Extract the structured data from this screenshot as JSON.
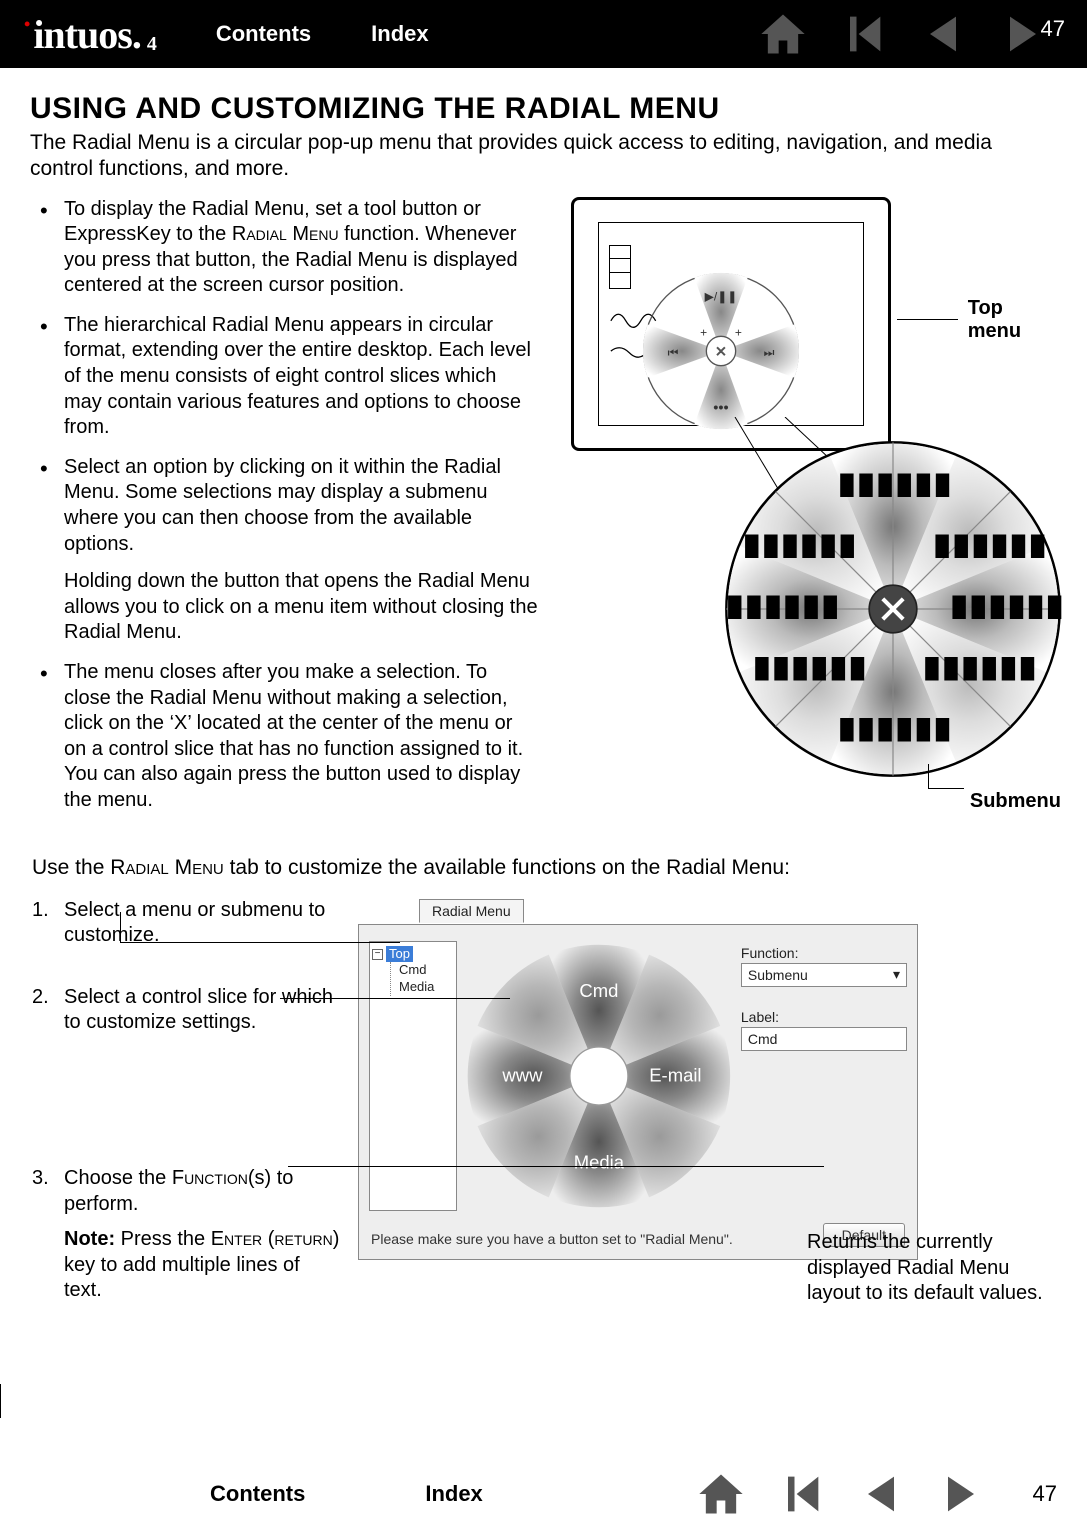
{
  "header": {
    "brand_main": "intuos",
    "brand_sub": "4",
    "contents": "Contents",
    "index": "Index",
    "page": "47"
  },
  "title": "USING AND CUSTOMIZING THE RADIAL MENU",
  "intro": "The Radial Menu is a circular pop-up menu that provides quick access to editing, navigation, and media control functions, and more.",
  "smallcaps": {
    "radial_menu": "Radial Menu",
    "function": "Function",
    "enter": "Enter",
    "return": "return"
  },
  "bullets": {
    "b1a": "To display the Radial Menu, set a tool button or ExpressKey to the ",
    "b1b": " function. Whenever you press that button, the Radial Menu is displayed centered at the screen cursor position.",
    "b2": "The hierarchical Radial Menu appears in circular format, extending over the entire desktop.  Each level of the menu consists of eight control slices which may contain various features and options to choose from.",
    "b3a": "Select an option by clicking on it within the Radial Menu.  Some selections may display a submenu where you can then choose from the available options.",
    "b3b": "Holding down the button that opens the Radial Menu allows you to click on a menu item without closing the Radial Menu.",
    "b4": "The menu closes after you make a selection.  To close the Radial Menu without making a selection, click on the ‘X’ located at the center of the menu or on a control slice that has no function assigned to it.  You can also again press the button used to display the menu."
  },
  "callouts": {
    "top": "Top menu",
    "sub": "Submenu"
  },
  "lead_a": "Use the ",
  "lead_b": " tab to customize the available functions on the Radial Menu:",
  "steps": {
    "s1": "Select a menu or submenu to customize.",
    "s2": "Select a control slice for which to customize settings.",
    "s3a": "Choose the ",
    "s3b": "(s) to perform.",
    "note_label": "Note:",
    "note_a": " Press the ",
    "note_b": " (",
    "note_c": ") key to add multiple lines of text."
  },
  "panel": {
    "tab": "Radial Menu",
    "tree_root": "Top",
    "tree_c1": "Cmd",
    "tree_c2": "Media",
    "slice_top": "Cmd",
    "slice_left": "www",
    "slice_right": "E-mail",
    "slice_bottom": "Media",
    "func_label": "Function:",
    "func_value": "Submenu",
    "label_label": "Label:",
    "label_value": "Cmd",
    "msg": "Please make sure you have a button set to \"Radial Menu\".",
    "default_btn": "Default"
  },
  "returns": "Returns the currently displayed Radial Menu layout to its default values.",
  "footer": {
    "contents": "Contents",
    "index": "Index",
    "page": "47"
  }
}
